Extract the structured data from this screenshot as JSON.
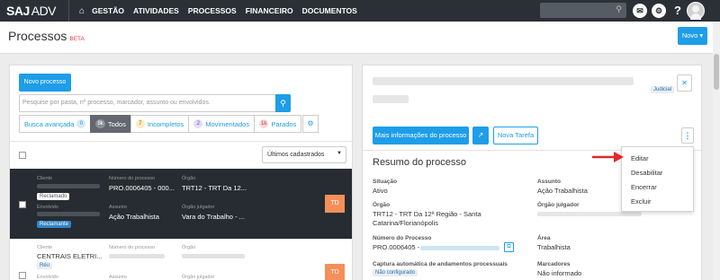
{
  "app": {
    "logo_main": "SAJ",
    "logo_sub": "ADV"
  },
  "nav": {
    "items": [
      "GESTÃO",
      "ATIVIDADES",
      "PROCESSOS",
      "FINANCEIRO",
      "DOCUMENTOS"
    ]
  },
  "toolbar": {
    "help": "?"
  },
  "page": {
    "title": "Processos",
    "beta": "BETA",
    "novo_button": "Novo ▾"
  },
  "left": {
    "new_process": "Novo processo",
    "search_placeholder": "Pesquise por pasta, nº processo, marcador, assunto ou envolvidos.",
    "advanced_search": "Busca avançada",
    "advanced_count": "0",
    "filters": [
      {
        "count": "8k",
        "label": "Todos"
      },
      {
        "count": "7",
        "label": "Incompletos"
      },
      {
        "count": "2",
        "label": "Movimentados"
      },
      {
        "count": "1k",
        "label": "Parados"
      }
    ],
    "sort_value": "Últimos cadastrados",
    "rows": [
      {
        "cliente_label": "Cliente",
        "tag1": "Reclamado",
        "envolvido_label": "Envolvido",
        "tag2": "Reclamante",
        "numero_label": "Número do processo",
        "numero": "PRO.0006405 - 000...",
        "orgao_label": "Órgão",
        "orgao": "TRT12 - TRT Da 12...",
        "assunto_label": "Assunto",
        "assunto": "Ação Trabalhista",
        "julgador_label": "Órgão julgador",
        "julgador": "Vara do Trabalho - ...",
        "owner": "TD"
      },
      {
        "cliente_label": "Cliente",
        "cliente": "CENTRAIS ELETRI...",
        "tag1": "Réu",
        "envolvido_label": "Envolvido",
        "numero_label": "Número do processo",
        "orgao_label": "Órgão",
        "assunto_label": "Assunto",
        "julgador_label": "Órgão julgador",
        "owner": "TD"
      }
    ]
  },
  "right": {
    "badge": "Judicial",
    "more_info": "Mais informações do processo",
    "new_task": "Nova Tarefa",
    "section_title": "Resumo do processo",
    "fields": {
      "situacao_label": "Situação",
      "situacao": "Ativo",
      "assunto_label": "Assunto",
      "assunto": "Ação Trabalhista",
      "orgao_label": "Órgão",
      "orgao": "TRT12 - TRT Da 12ª Região - Santa Catarina/Florianópolis",
      "julgador_label": "Órgão julgador",
      "numero_label": "Número do Processo",
      "numero": "PRO.0006405 -",
      "area_label": "Área",
      "area": "Trabalhista",
      "captura_label": "Captura automática de andamentos processuais",
      "captura": "Não configurado",
      "marcadores_label": "Marcadores",
      "marcadores": "Não informado"
    }
  },
  "menu": {
    "items": [
      "Editar",
      "Desabilitar",
      "Encerrar",
      "Excluir"
    ]
  },
  "colors": {
    "primary": "#1e9de8",
    "topbar": "#2a3036",
    "arrow": "#e5252a",
    "owner": "#f58f5a"
  }
}
